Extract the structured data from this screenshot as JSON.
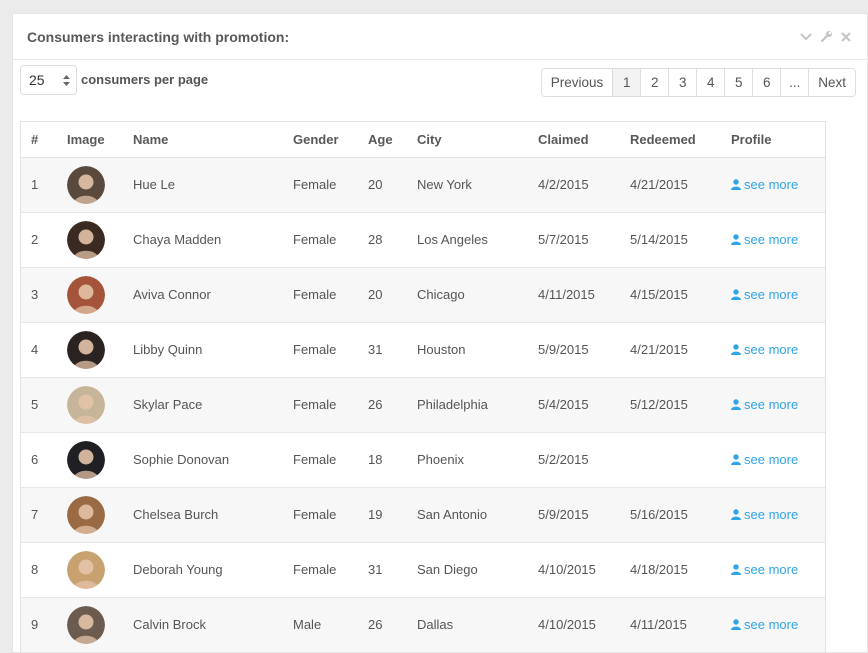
{
  "panel": {
    "title": "Consumers interacting with promotion:",
    "tools": [
      "chevron-down-icon",
      "wrench-icon",
      "close-icon"
    ]
  },
  "controls": {
    "per_page_value": "25",
    "per_page_label": "consumers per page"
  },
  "pagination": {
    "previous": "Previous",
    "pages": [
      "1",
      "2",
      "3",
      "4",
      "5",
      "6",
      "..."
    ],
    "active_page": "1",
    "next": "Next"
  },
  "table": {
    "headers": [
      "#",
      "Image",
      "Name",
      "Gender",
      "Age",
      "City",
      "Claimed",
      "Redeemed",
      "Profile"
    ],
    "link_label": "see more",
    "rows": [
      {
        "num": "1",
        "name": "Hue Le",
        "gender": "Female",
        "age": "20",
        "city": "New York",
        "claimed": "4/2/2015",
        "redeemed": "4/21/2015"
      },
      {
        "num": "2",
        "name": "Chaya Madden",
        "gender": "Female",
        "age": "28",
        "city": "Los Angeles",
        "claimed": "5/7/2015",
        "redeemed": "5/14/2015"
      },
      {
        "num": "3",
        "name": "Aviva Connor",
        "gender": "Female",
        "age": "20",
        "city": "Chicago",
        "claimed": "4/11/2015",
        "redeemed": "4/15/2015"
      },
      {
        "num": "4",
        "name": "Libby Quinn",
        "gender": "Female",
        "age": "31",
        "city": "Houston",
        "claimed": "5/9/2015",
        "redeemed": "4/21/2015"
      },
      {
        "num": "5",
        "name": "Skylar Pace",
        "gender": "Female",
        "age": "26",
        "city": "Philadelphia",
        "claimed": "5/4/2015",
        "redeemed": "5/12/2015"
      },
      {
        "num": "6",
        "name": "Sophie Donovan",
        "gender": "Female",
        "age": "18",
        "city": "Phoenix",
        "claimed": "5/2/2015",
        "redeemed": ""
      },
      {
        "num": "7",
        "name": "Chelsea Burch",
        "gender": "Female",
        "age": "19",
        "city": "San Antonio",
        "claimed": "5/9/2015",
        "redeemed": "5/16/2015"
      },
      {
        "num": "8",
        "name": "Deborah Young",
        "gender": "Female",
        "age": "31",
        "city": "San Diego",
        "claimed": "4/10/2015",
        "redeemed": "4/18/2015"
      },
      {
        "num": "9",
        "name": "Calvin Brock",
        "gender": "Male",
        "age": "26",
        "city": "Dallas",
        "claimed": "4/10/2015",
        "redeemed": "4/11/2015"
      }
    ]
  },
  "colors": {
    "link": "#2fa4e7",
    "avatars": [
      "#5a4a3e",
      "#3b2a22",
      "#a3543a",
      "#2b2321",
      "#c7b59a",
      "#1f1f24",
      "#9a6a44",
      "#c8a170",
      "#6c5b4f"
    ]
  }
}
